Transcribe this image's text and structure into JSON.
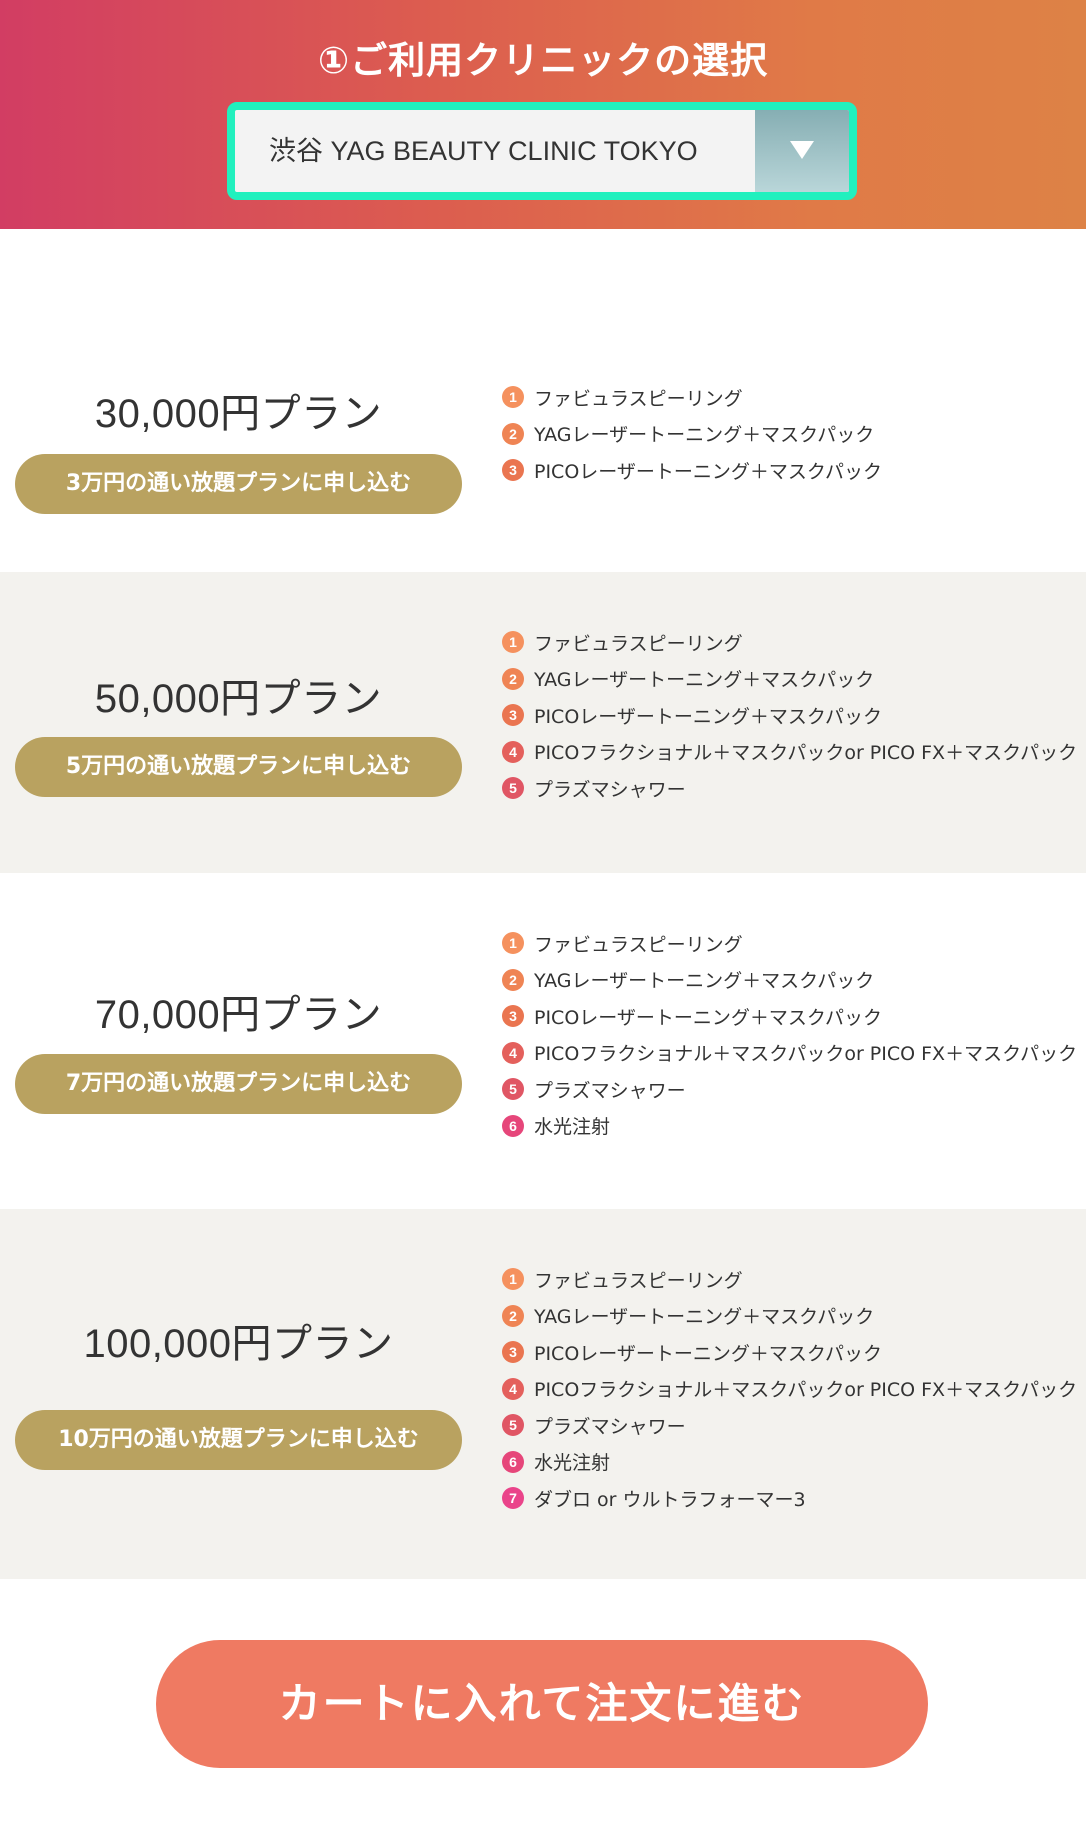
{
  "header": {
    "title": "①ご利用クリニックの選択",
    "clinic_select": {
      "value": "渋谷 YAG BEAUTY CLINIC TOKYO"
    }
  },
  "colors": {
    "item_1": "#f5915e",
    "item_2": "#ef8454",
    "item_3": "#ea7550",
    "item_4": "#e4605c",
    "item_5": "#e05664",
    "item_6": "#e6467a",
    "item_7": "#ea448a",
    "plan_button": "#b9a260",
    "cta": "#ef7a62",
    "select_border": "#21f0be"
  },
  "plans": [
    {
      "price": "30,000円プラン",
      "button": "3万円の通い放題プランに申し込む",
      "items": [
        {
          "num": "1",
          "label": "ファビュラスピーリング"
        },
        {
          "num": "2",
          "label": "YAGレーザートーニング＋マスクパック"
        },
        {
          "num": "3",
          "label": "PICOレーザートーニング＋マスクパック"
        }
      ]
    },
    {
      "price": "50,000円プラン",
      "button": "5万円の通い放題プランに申し込む",
      "items": [
        {
          "num": "1",
          "label": "ファビュラスピーリング"
        },
        {
          "num": "2",
          "label": "YAGレーザートーニング＋マスクパック"
        },
        {
          "num": "3",
          "label": "PICOレーザートーニング＋マスクパック"
        },
        {
          "num": "4",
          "label": "PICOフラクショナル＋マスクパックor PICO FX＋マスクパック"
        },
        {
          "num": "5",
          "label": "プラズマシャワー"
        }
      ]
    },
    {
      "price": "70,000円プラン",
      "button": "7万円の通い放題プランに申し込む",
      "items": [
        {
          "num": "1",
          "label": "ファビュラスピーリング"
        },
        {
          "num": "2",
          "label": "YAGレーザートーニング＋マスクパック"
        },
        {
          "num": "3",
          "label": "PICOレーザートーニング＋マスクパック"
        },
        {
          "num": "4",
          "label": "PICOフラクショナル＋マスクパックor PICO FX＋マスクパック"
        },
        {
          "num": "5",
          "label": "プラズマシャワー"
        },
        {
          "num": "6",
          "label": "水光注射"
        }
      ]
    },
    {
      "price": "100,000円プラン",
      "button": "10万円の通い放題プランに申し込む",
      "items": [
        {
          "num": "1",
          "label": "ファビュラスピーリング"
        },
        {
          "num": "2",
          "label": "YAGレーザートーニング＋マスクパック"
        },
        {
          "num": "3",
          "label": "PICOレーザートーニング＋マスクパック"
        },
        {
          "num": "4",
          "label": "PICOフラクショナル＋マスクパックor PICO FX＋マスクパック"
        },
        {
          "num": "5",
          "label": "プラズマシャワー"
        },
        {
          "num": "6",
          "label": "水光注射"
        },
        {
          "num": "7",
          "label": "ダブロ or ウルトラフォーマー3"
        }
      ]
    }
  ],
  "cta": {
    "label": "カートに入れて注文に進む"
  }
}
